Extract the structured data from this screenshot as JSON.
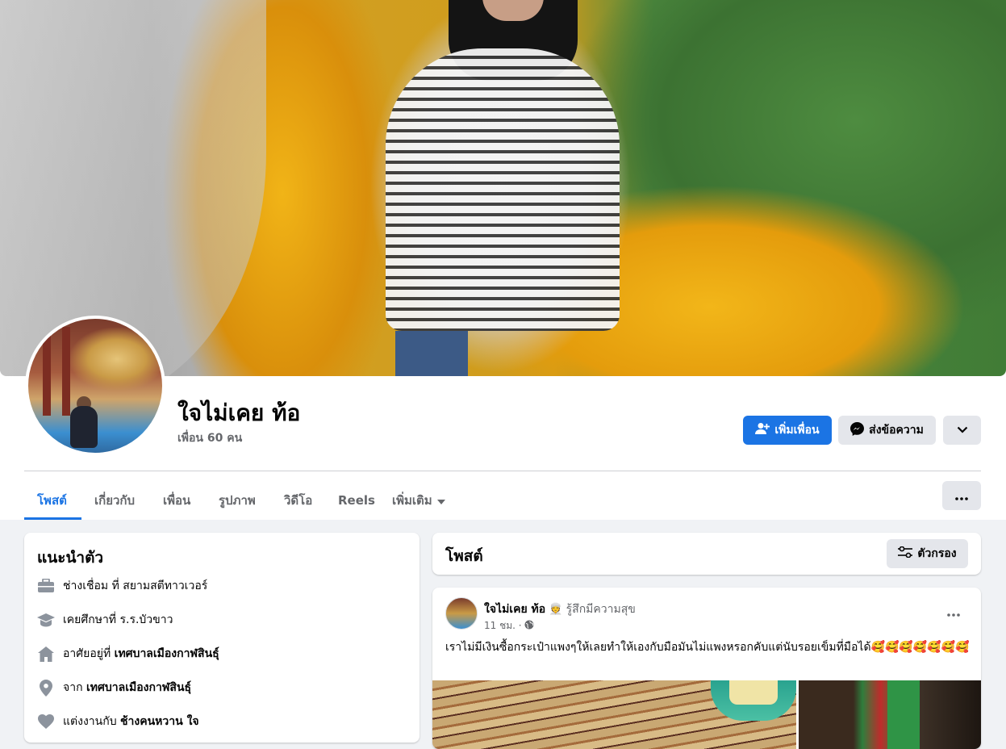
{
  "profile": {
    "name": "ใจไม่เคย ท้อ",
    "friends_count": "เพื่อน 60 คน"
  },
  "actions": {
    "add_friend": "เพิ่มเพื่อน",
    "message": "ส่งข้อความ"
  },
  "tabs": [
    {
      "label": "โพสต์",
      "active": true
    },
    {
      "label": "เกี่ยวกับ"
    },
    {
      "label": "เพื่อน"
    },
    {
      "label": "รูปภาพ"
    },
    {
      "label": "วิดีโอ"
    },
    {
      "label": "Reels"
    },
    {
      "label": "เพิ่มเติม"
    }
  ],
  "intro": {
    "title": "แนะนำตัว",
    "items": [
      {
        "icon": "briefcase-icon",
        "prefix": "ช่างเชื่อม ที่ สยามสตีทาวเวอร์",
        "bold": ""
      },
      {
        "icon": "graduation-cap-icon",
        "prefix": "เคยศึกษาที่ ร.ร.บัวขาว",
        "bold": ""
      },
      {
        "icon": "home-icon",
        "prefix": "อาศัยอยู่ที่ ",
        "bold": "เทศบาลเมืองกาฬสินธุ์"
      },
      {
        "icon": "location-pin-icon",
        "prefix": "จาก ",
        "bold": "เทศบาลเมืองกาฬสินธุ์"
      },
      {
        "icon": "heart-icon",
        "prefix": "แต่งงานกับ ",
        "bold": "ช้างคนหวาน ใจ"
      }
    ]
  },
  "posts_section": {
    "title": "โพสต์",
    "filter_label": "ตัวกรอง"
  },
  "post": {
    "author": "ใจไม่เคย ท้อ",
    "feeling_emoji": "👳",
    "feeling": "รู้สึกมีความสุข",
    "time": "11 ชม. ·",
    "privacy_icon": "globe-icon",
    "text": "เราไม่มีเงินซื้อกระเป๋าแพงๆให้เลยทำให้เองกับมือมันไม่แพงหรอกคับแต่นับรอยเข็มที่มือได้🥰🥰🥰🥰🥰🥰🥰"
  },
  "colors": {
    "accent": "#1b74e4",
    "background": "#f0f2f5",
    "secondary_button": "#e4e6eb",
    "muted_text": "#65676b"
  }
}
